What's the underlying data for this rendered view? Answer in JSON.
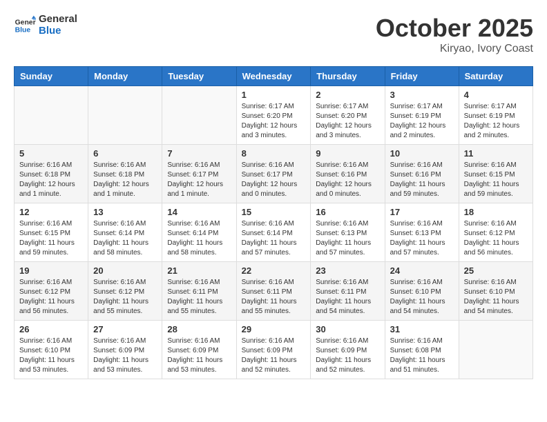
{
  "header": {
    "logo_line1": "General",
    "logo_line2": "Blue",
    "month": "October 2025",
    "location": "Kiryao, Ivory Coast"
  },
  "weekdays": [
    "Sunday",
    "Monday",
    "Tuesday",
    "Wednesday",
    "Thursday",
    "Friday",
    "Saturday"
  ],
  "weeks": [
    [
      {
        "day": "",
        "info": ""
      },
      {
        "day": "",
        "info": ""
      },
      {
        "day": "",
        "info": ""
      },
      {
        "day": "1",
        "info": "Sunrise: 6:17 AM\nSunset: 6:20 PM\nDaylight: 12 hours and 3 minutes."
      },
      {
        "day": "2",
        "info": "Sunrise: 6:17 AM\nSunset: 6:20 PM\nDaylight: 12 hours and 3 minutes."
      },
      {
        "day": "3",
        "info": "Sunrise: 6:17 AM\nSunset: 6:19 PM\nDaylight: 12 hours and 2 minutes."
      },
      {
        "day": "4",
        "info": "Sunrise: 6:17 AM\nSunset: 6:19 PM\nDaylight: 12 hours and 2 minutes."
      }
    ],
    [
      {
        "day": "5",
        "info": "Sunrise: 6:16 AM\nSunset: 6:18 PM\nDaylight: 12 hours and 1 minute."
      },
      {
        "day": "6",
        "info": "Sunrise: 6:16 AM\nSunset: 6:18 PM\nDaylight: 12 hours and 1 minute."
      },
      {
        "day": "7",
        "info": "Sunrise: 6:16 AM\nSunset: 6:17 PM\nDaylight: 12 hours and 1 minute."
      },
      {
        "day": "8",
        "info": "Sunrise: 6:16 AM\nSunset: 6:17 PM\nDaylight: 12 hours and 0 minutes."
      },
      {
        "day": "9",
        "info": "Sunrise: 6:16 AM\nSunset: 6:16 PM\nDaylight: 12 hours and 0 minutes."
      },
      {
        "day": "10",
        "info": "Sunrise: 6:16 AM\nSunset: 6:16 PM\nDaylight: 11 hours and 59 minutes."
      },
      {
        "day": "11",
        "info": "Sunrise: 6:16 AM\nSunset: 6:15 PM\nDaylight: 11 hours and 59 minutes."
      }
    ],
    [
      {
        "day": "12",
        "info": "Sunrise: 6:16 AM\nSunset: 6:15 PM\nDaylight: 11 hours and 59 minutes."
      },
      {
        "day": "13",
        "info": "Sunrise: 6:16 AM\nSunset: 6:14 PM\nDaylight: 11 hours and 58 minutes."
      },
      {
        "day": "14",
        "info": "Sunrise: 6:16 AM\nSunset: 6:14 PM\nDaylight: 11 hours and 58 minutes."
      },
      {
        "day": "15",
        "info": "Sunrise: 6:16 AM\nSunset: 6:14 PM\nDaylight: 11 hours and 57 minutes."
      },
      {
        "day": "16",
        "info": "Sunrise: 6:16 AM\nSunset: 6:13 PM\nDaylight: 11 hours and 57 minutes."
      },
      {
        "day": "17",
        "info": "Sunrise: 6:16 AM\nSunset: 6:13 PM\nDaylight: 11 hours and 57 minutes."
      },
      {
        "day": "18",
        "info": "Sunrise: 6:16 AM\nSunset: 6:12 PM\nDaylight: 11 hours and 56 minutes."
      }
    ],
    [
      {
        "day": "19",
        "info": "Sunrise: 6:16 AM\nSunset: 6:12 PM\nDaylight: 11 hours and 56 minutes."
      },
      {
        "day": "20",
        "info": "Sunrise: 6:16 AM\nSunset: 6:12 PM\nDaylight: 11 hours and 55 minutes."
      },
      {
        "day": "21",
        "info": "Sunrise: 6:16 AM\nSunset: 6:11 PM\nDaylight: 11 hours and 55 minutes."
      },
      {
        "day": "22",
        "info": "Sunrise: 6:16 AM\nSunset: 6:11 PM\nDaylight: 11 hours and 55 minutes."
      },
      {
        "day": "23",
        "info": "Sunrise: 6:16 AM\nSunset: 6:11 PM\nDaylight: 11 hours and 54 minutes."
      },
      {
        "day": "24",
        "info": "Sunrise: 6:16 AM\nSunset: 6:10 PM\nDaylight: 11 hours and 54 minutes."
      },
      {
        "day": "25",
        "info": "Sunrise: 6:16 AM\nSunset: 6:10 PM\nDaylight: 11 hours and 54 minutes."
      }
    ],
    [
      {
        "day": "26",
        "info": "Sunrise: 6:16 AM\nSunset: 6:10 PM\nDaylight: 11 hours and 53 minutes."
      },
      {
        "day": "27",
        "info": "Sunrise: 6:16 AM\nSunset: 6:09 PM\nDaylight: 11 hours and 53 minutes."
      },
      {
        "day": "28",
        "info": "Sunrise: 6:16 AM\nSunset: 6:09 PM\nDaylight: 11 hours and 53 minutes."
      },
      {
        "day": "29",
        "info": "Sunrise: 6:16 AM\nSunset: 6:09 PM\nDaylight: 11 hours and 52 minutes."
      },
      {
        "day": "30",
        "info": "Sunrise: 6:16 AM\nSunset: 6:09 PM\nDaylight: 11 hours and 52 minutes."
      },
      {
        "day": "31",
        "info": "Sunrise: 6:16 AM\nSunset: 6:08 PM\nDaylight: 11 hours and 51 minutes."
      },
      {
        "day": "",
        "info": ""
      }
    ]
  ]
}
